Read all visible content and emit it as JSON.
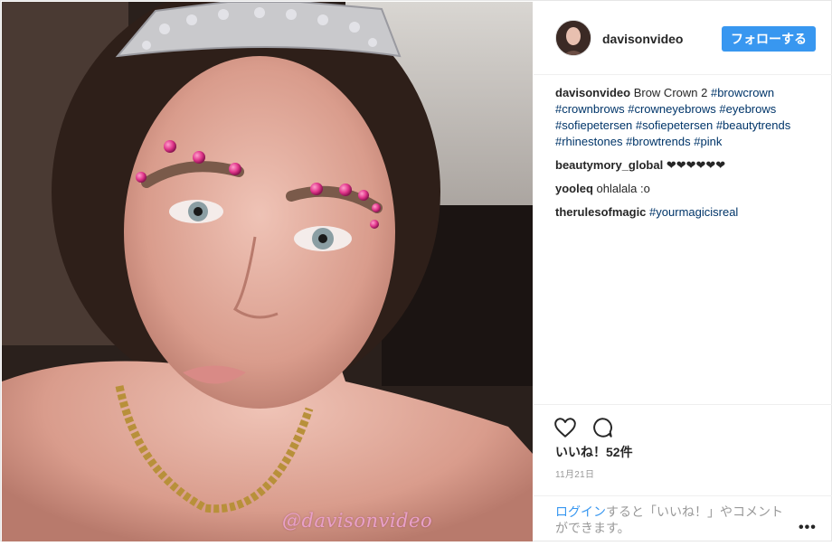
{
  "post": {
    "watermark": "@davisonvideo"
  },
  "header": {
    "username": "davisonvideo",
    "follow_label": "フォローする"
  },
  "comments": [
    {
      "user": "davisonvideo",
      "text": "Brow Crown 2",
      "hashtags": [
        "#browcrown",
        "#crownbrows",
        "#crowneyebrows",
        "#eyebrows",
        "#sofiepetersen",
        "#sofiepetersen",
        "#beautytrends",
        "#rhinestones",
        "#browtrends",
        "#pink"
      ]
    },
    {
      "user": "beautymory_global",
      "text": "❤❤❤❤❤❤"
    },
    {
      "user": "yooleq",
      "text": "ohlalala :o"
    },
    {
      "user": "therulesofmagic",
      "text": "",
      "hashtags": [
        "#yourmagicisreal"
      ]
    }
  ],
  "actions": {
    "like_icon": "heart-outline-icon",
    "comment_icon": "speech-bubble-icon",
    "likes_label": "いいね！52件",
    "date": "11月21日"
  },
  "login": {
    "link_label": "ログイン",
    "rest_text": "すると「いいね！」やコメントができます。",
    "more_label": "•••"
  },
  "colors": {
    "accent": "#3897f0",
    "hashtag": "#003569",
    "rhinestone": "#e0358a"
  }
}
